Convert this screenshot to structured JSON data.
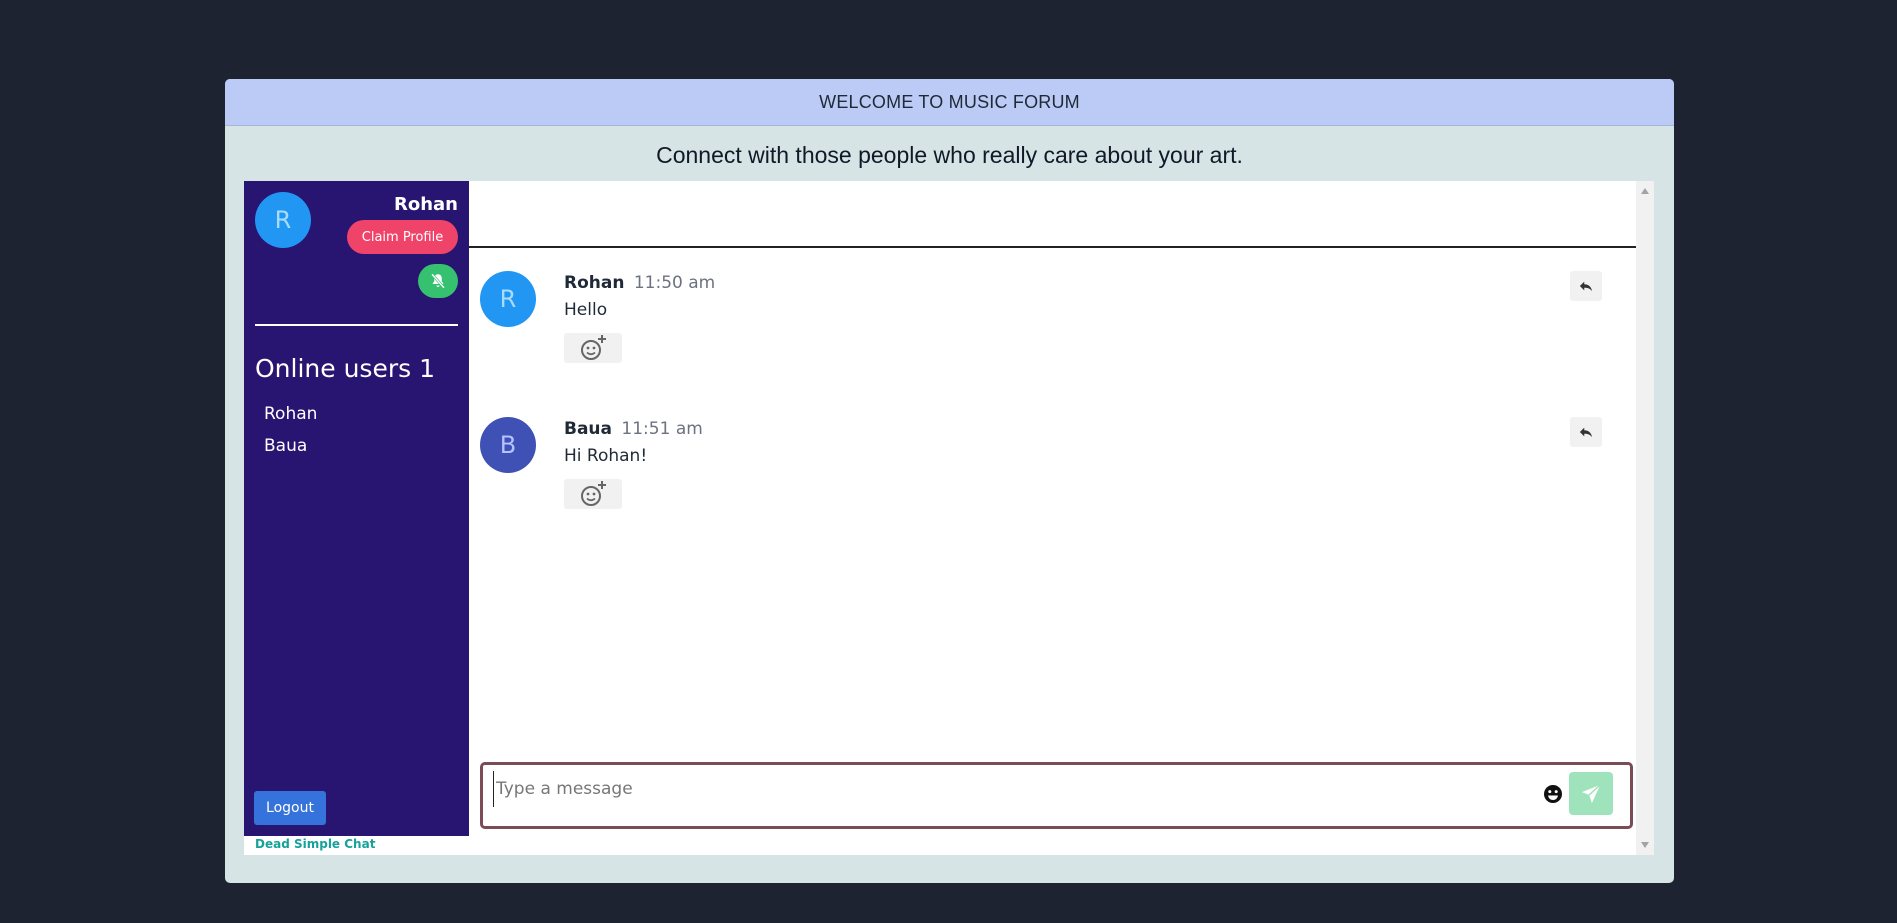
{
  "header": {
    "title": "WELCOME TO MUSIC FORUM",
    "tagline": "Connect with those people who really care about your art."
  },
  "sidebar": {
    "current_user": {
      "initial": "R",
      "name": "Rohan",
      "claim_label": "Claim Profile",
      "mute_icon": "bell-slash-icon"
    },
    "online_title": "Online users",
    "online_count": "1",
    "users": [
      "Rohan",
      "Baua"
    ],
    "logout_label": "Logout",
    "powered_by": "Dead Simple Chat"
  },
  "messages": [
    {
      "initial": "R",
      "author": "Rohan",
      "time": "11:50 am",
      "text": "Hello",
      "avatar_color": "#2196f3",
      "avatar_text_color": "#a8dcff"
    },
    {
      "initial": "B",
      "author": "Baua",
      "time": "11:51 am",
      "text": "Hi Rohan!",
      "avatar_color": "#3f51b5",
      "avatar_text_color": "#b6c2ff"
    }
  ],
  "composer": {
    "placeholder": "Type a message",
    "emoji_icon": "smiley-icon",
    "send_icon": "paper-plane-icon"
  },
  "colors": {
    "background": "#1e2331",
    "header_bg": "#bccbf5",
    "sidebar_bg": "#281571",
    "claim_bg": "#f0436a",
    "mute_bg": "#35c170",
    "logout_bg": "#3572db",
    "send_bg": "#9ee3bb",
    "brand_green": "#16a29a"
  }
}
